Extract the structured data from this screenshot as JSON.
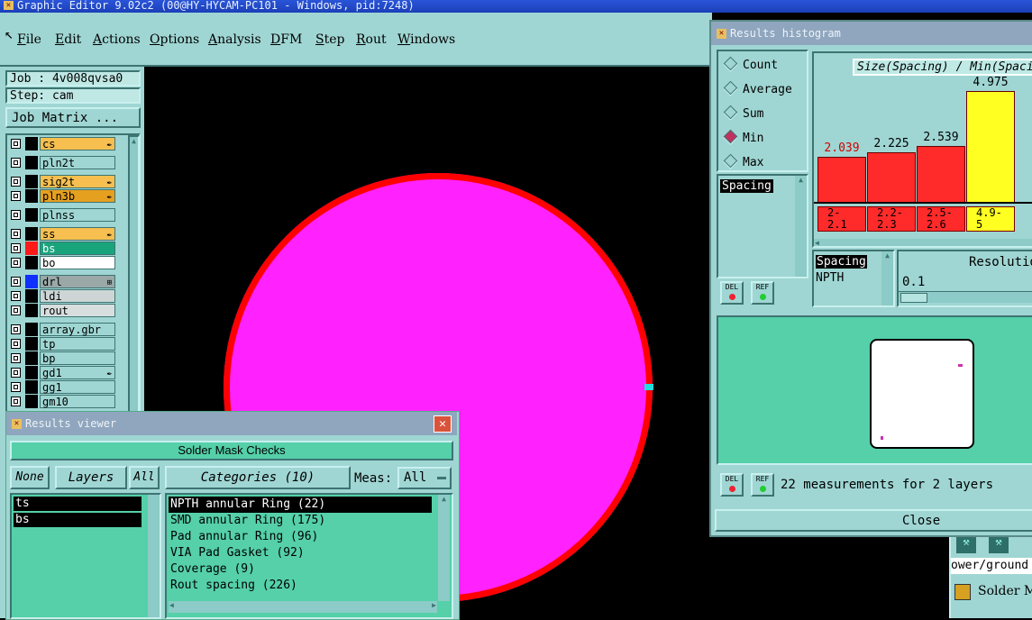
{
  "app": {
    "title": "Graphic Editor 9.02c2 (00@HY-HYCAM-PC101 - Windows, pid:7248)",
    "menu": [
      "File",
      "Edit",
      "Actions",
      "Options",
      "Analysis",
      "DFM",
      "Step",
      "Rout",
      "Windows"
    ]
  },
  "job": {
    "job_label": "Job : 4v008qvsa0",
    "step_label": "Step: cam",
    "matrix_button": "Job Matrix ..."
  },
  "layers": [
    {
      "name": "cs",
      "color": "#000000",
      "fill": "#f6bf50",
      "mark": "✒"
    },
    {
      "name": "pln2t",
      "color": "#000000",
      "fill": "#9fd6d3",
      "mark": ""
    },
    {
      "name": "sig2t",
      "color": "#000000",
      "fill": "#f6bf50",
      "mark": "✒"
    },
    {
      "name": "pln3b",
      "color": "#000000",
      "fill": "#e6a020",
      "mark": "✒"
    },
    {
      "name": "plnss",
      "color": "#000000",
      "fill": "#9fd6d3",
      "mark": ""
    },
    {
      "name": "ss",
      "color": "#000000",
      "fill": "#f6bf50",
      "mark": "✒"
    },
    {
      "name": "bs",
      "color": "#ff1a1a",
      "fill": "#1aa47c",
      "mark": ""
    },
    {
      "name": "bo",
      "color": "#000000",
      "fill": "#ffffff",
      "mark": ""
    },
    {
      "name": "drl",
      "color": "#1030ff",
      "fill": "#9aa8a8",
      "mark": "⊞"
    },
    {
      "name": "ldi",
      "color": "#000000",
      "fill": "#cdd5d5",
      "mark": ""
    },
    {
      "name": "rout",
      "color": "#000000",
      "fill": "#d8dede",
      "mark": ""
    },
    {
      "name": "array.gbr",
      "color": "#000000",
      "fill": "#9fd6d3",
      "mark": ""
    },
    {
      "name": "tp",
      "color": "#000000",
      "fill": "#9fd6d3",
      "mark": ""
    },
    {
      "name": "bp",
      "color": "#000000",
      "fill": "#9fd6d3",
      "mark": ""
    },
    {
      "name": "gd1",
      "color": "#000000",
      "fill": "#9fd6d3",
      "mark": "✒"
    },
    {
      "name": "gg1",
      "color": "#000000",
      "fill": "#9fd6d3",
      "mark": ""
    },
    {
      "name": "gm10",
      "color": "#000000",
      "fill": "#9fd6d3",
      "mark": ""
    }
  ],
  "results_viewer": {
    "title": "Results viewer",
    "header": "Solder Mask Checks",
    "none_btn": "None",
    "layers_btn": "Layers",
    "all_btn": "All",
    "categories_btn": "Categories (10)",
    "meas_label": "Meas:",
    "meas_value": "All",
    "layer_list": [
      "ts",
      "bs"
    ],
    "categories": [
      "NPTH annular Ring (22)",
      "SMD annular Ring (175)",
      "Pad annular Ring (96)",
      "VIA Pad Gasket (92)",
      "Coverage (9)",
      "Rout spacing (226)"
    ]
  },
  "histogram": {
    "title": "Results histogram",
    "options": [
      "Count",
      "Average",
      "Sum",
      "Min",
      "Max"
    ],
    "selected": "Min",
    "graph_title": "Size(Spacing) / Min(Spacing)",
    "list_item": "Spacing",
    "del_label": "DEL",
    "ref_label": "REF",
    "spacing_header": "Spacing",
    "spacing_value": "NPTH",
    "resolution_label": "Resolution",
    "resolution_value": "0.1",
    "measurements": "22 measurements for 2 layers",
    "close_label": "Close",
    "bars": [
      {
        "min": 2.039,
        "label": "2.039",
        "bin": "2- 2.1",
        "color": "#ff2a2a",
        "text": "#d00000"
      },
      {
        "min": 2.225,
        "label": "2.225",
        "bin": "2.2- 2.3",
        "color": "#ff2a2a",
        "text": "#000000"
      },
      {
        "min": 2.539,
        "label": "2.539",
        "bin": "2.5- 2.6",
        "color": "#ff2a2a",
        "text": "#000000"
      },
      {
        "min": 4.975,
        "label": "4.975",
        "bin": "4.9- 5",
        "color": "#ffff22",
        "text": "#000000"
      }
    ]
  },
  "background_window": {
    "path_text": "ower/ground",
    "label": "Solder Ma"
  },
  "canvas": {
    "pad_color": "#ff22ff",
    "ring_color": "#ff0000"
  }
}
